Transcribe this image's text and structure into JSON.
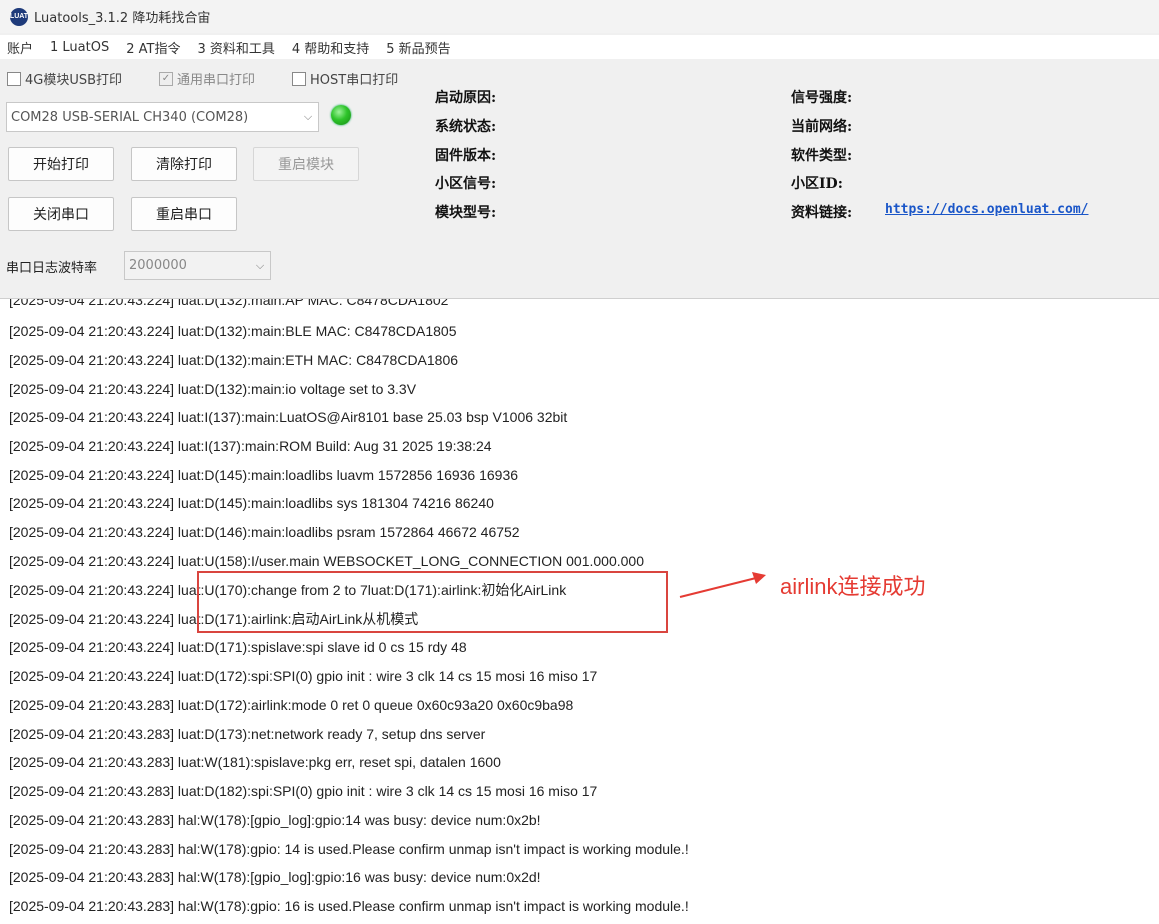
{
  "window": {
    "title": "Luatools_3.1.2 降功耗找合宙",
    "app_icon_text": "LUAT"
  },
  "menu": [
    "账户",
    "1 LuatOS",
    "2 AT指令",
    "3 资料和工具",
    "4 帮助和支持",
    "5 新品预告"
  ],
  "print_options": {
    "usb_4g": {
      "label": "4G模块USB打印",
      "checked": false,
      "enabled": true
    },
    "uart": {
      "label": "通用串口打印",
      "checked": true,
      "enabled": false
    },
    "host": {
      "label": "HOST串口打印",
      "checked": false,
      "enabled": true
    }
  },
  "port_select": {
    "value": "COM28 USB-SERIAL CH340 (COM28)"
  },
  "status_led": {
    "color": "#2ec42a",
    "state": "connected"
  },
  "buttons": {
    "start_print": "开始打印",
    "clear_print": "清除打印",
    "restart_module": "重启模块",
    "close_port": "关闭串口",
    "restart_port": "重启串口"
  },
  "baud": {
    "label": "串口日志波特率",
    "value": "2000000"
  },
  "info": {
    "boot_reason": "启动原因:",
    "system_status": "系统状态:",
    "firmware_version": "固件版本:",
    "cell_signal": "小区信号:",
    "module_model": "模块型号:",
    "signal_strength": "信号强度:",
    "current_network": "当前网络:",
    "software_type": "软件类型:",
    "cell_id": "小区ID:",
    "docs_link_label": "资料链接:",
    "docs_link_url": "https://docs.openluat.com/"
  },
  "log_lines": [
    "[2025-09-04 21:20:43.224] luat:D(132):main:AP  MAC: C8478CDA1802",
    "[2025-09-04 21:20:43.224] luat:D(132):main:BLE MAC: C8478CDA1805",
    "[2025-09-04 21:20:43.224] luat:D(132):main:ETH MAC: C8478CDA1806",
    "[2025-09-04 21:20:43.224] luat:D(132):main:io voltage set to 3.3V",
    "[2025-09-04 21:20:43.224] luat:I(137):main:LuatOS@Air8101 base 25.03 bsp V1006 32bit",
    "[2025-09-04 21:20:43.224] luat:I(137):main:ROM Build: Aug 31 2025 19:38:24",
    "[2025-09-04 21:20:43.224] luat:D(145):main:loadlibs luavm 1572856 16936 16936",
    "[2025-09-04 21:20:43.224] luat:D(145):main:loadlibs sys   181304 74216 86240",
    "[2025-09-04 21:20:43.224] luat:D(146):main:loadlibs psram 1572864 46672 46752",
    "[2025-09-04 21:20:43.224] luat:U(158):I/user.main WEBSOCKET_LONG_CONNECTION 001.000.000",
    "[2025-09-04 21:20:43.224] luat:U(170):change from 2 to 7luat:D(171):airlink:初始化AirLink",
    "[2025-09-04 21:20:43.224] luat:D(171):airlink:启动AirLink从机模式",
    "[2025-09-04 21:20:43.224] luat:D(171):spislave:spi slave id 0 cs 15 rdy 48",
    "[2025-09-04 21:20:43.224] luat:D(172):spi:SPI(0) gpio init : wire 3 clk 14 cs 15 mosi 16 miso 17",
    "[2025-09-04 21:20:43.283] luat:D(172):airlink:mode 0 ret 0 queue 0x60c93a20 0x60c9ba98",
    "[2025-09-04 21:20:43.283] luat:D(173):net:network ready 7, setup dns server",
    "[2025-09-04 21:20:43.283] luat:W(181):spislave:pkg err, reset spi, datalen 1600",
    "[2025-09-04 21:20:43.283] luat:D(182):spi:SPI(0) gpio init : wire 3 clk 14 cs 15 mosi 16 miso 17",
    "[2025-09-04 21:20:43.283] hal:W(178):[gpio_log]:gpio:14 was busy: device num:0x2b!",
    "[2025-09-04 21:20:43.283] hal:W(178):gpio: 14 is used.Please confirm unmap isn't impact is working module.!",
    "[2025-09-04 21:20:43.283] hal:W(178):[gpio_log]:gpio:16 was busy: device num:0x2d!",
    "[2025-09-04 21:20:43.283] hal:W(178):gpio: 16 is used.Please confirm unmap isn't impact is working module.!"
  ],
  "annotation": {
    "text": "airlink连接成功",
    "color": "#e53b33"
  }
}
